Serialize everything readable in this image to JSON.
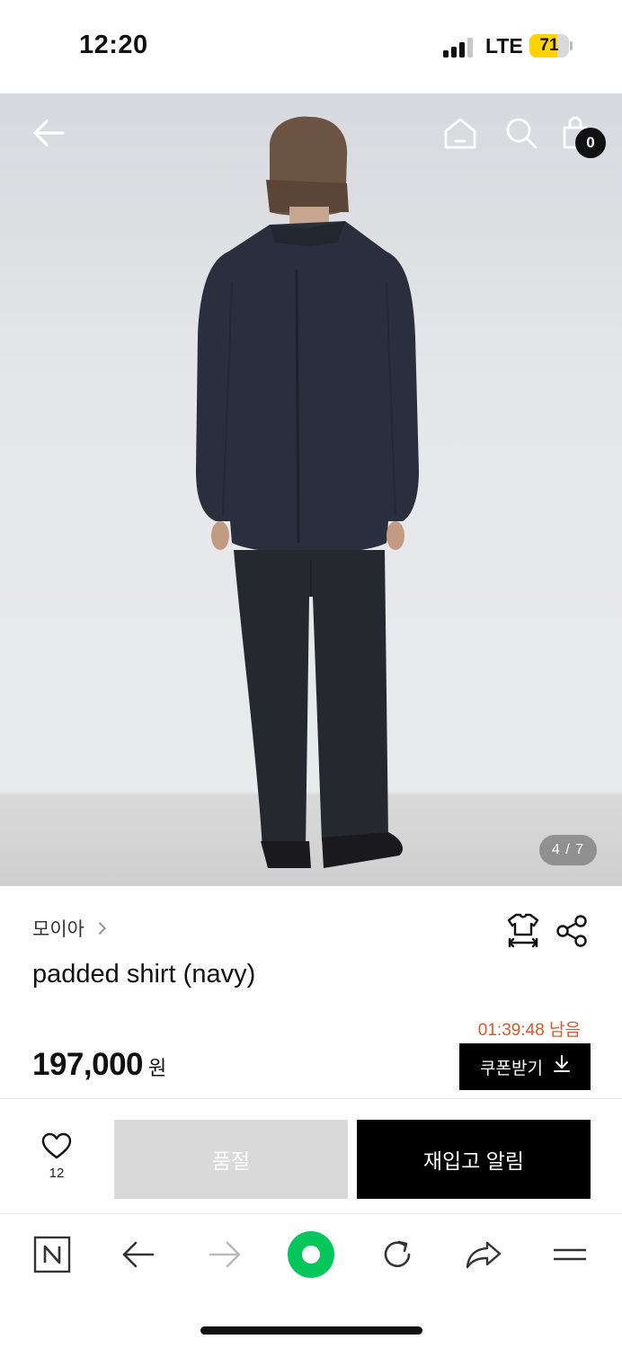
{
  "status_bar": {
    "time": "12:20",
    "network": "LTE",
    "battery": "71",
    "battery_level": 0.71
  },
  "header": {
    "icons": [
      "back-arrow-icon",
      "home-icon",
      "search-icon",
      "shopping-bag-icon"
    ],
    "cart_count": "0"
  },
  "gallery": {
    "counter": "4 / 7"
  },
  "product": {
    "brand": "모이아",
    "title": "padded shirt (navy)",
    "timer": "01:39:48 남음",
    "price": "197,000",
    "price_unit": "원",
    "coupon_label": "쿠폰받기",
    "icons": [
      "size-guide-icon",
      "share-icon",
      "download-icon"
    ]
  },
  "actions": {
    "like_count": "12",
    "soldout_label": "품절",
    "restock_label": "재입고 알림"
  },
  "browser_bar": {
    "icons": [
      "naver-n-icon",
      "back-icon",
      "forward-icon",
      "green-dot-icon",
      "refresh-icon",
      "share-arrow-icon",
      "menu-icon"
    ]
  },
  "colors": {
    "timer": "#d9572b",
    "accent_green": "#03c75a",
    "primary_button": "#000000",
    "disabled_button": "#d9d9d9"
  }
}
